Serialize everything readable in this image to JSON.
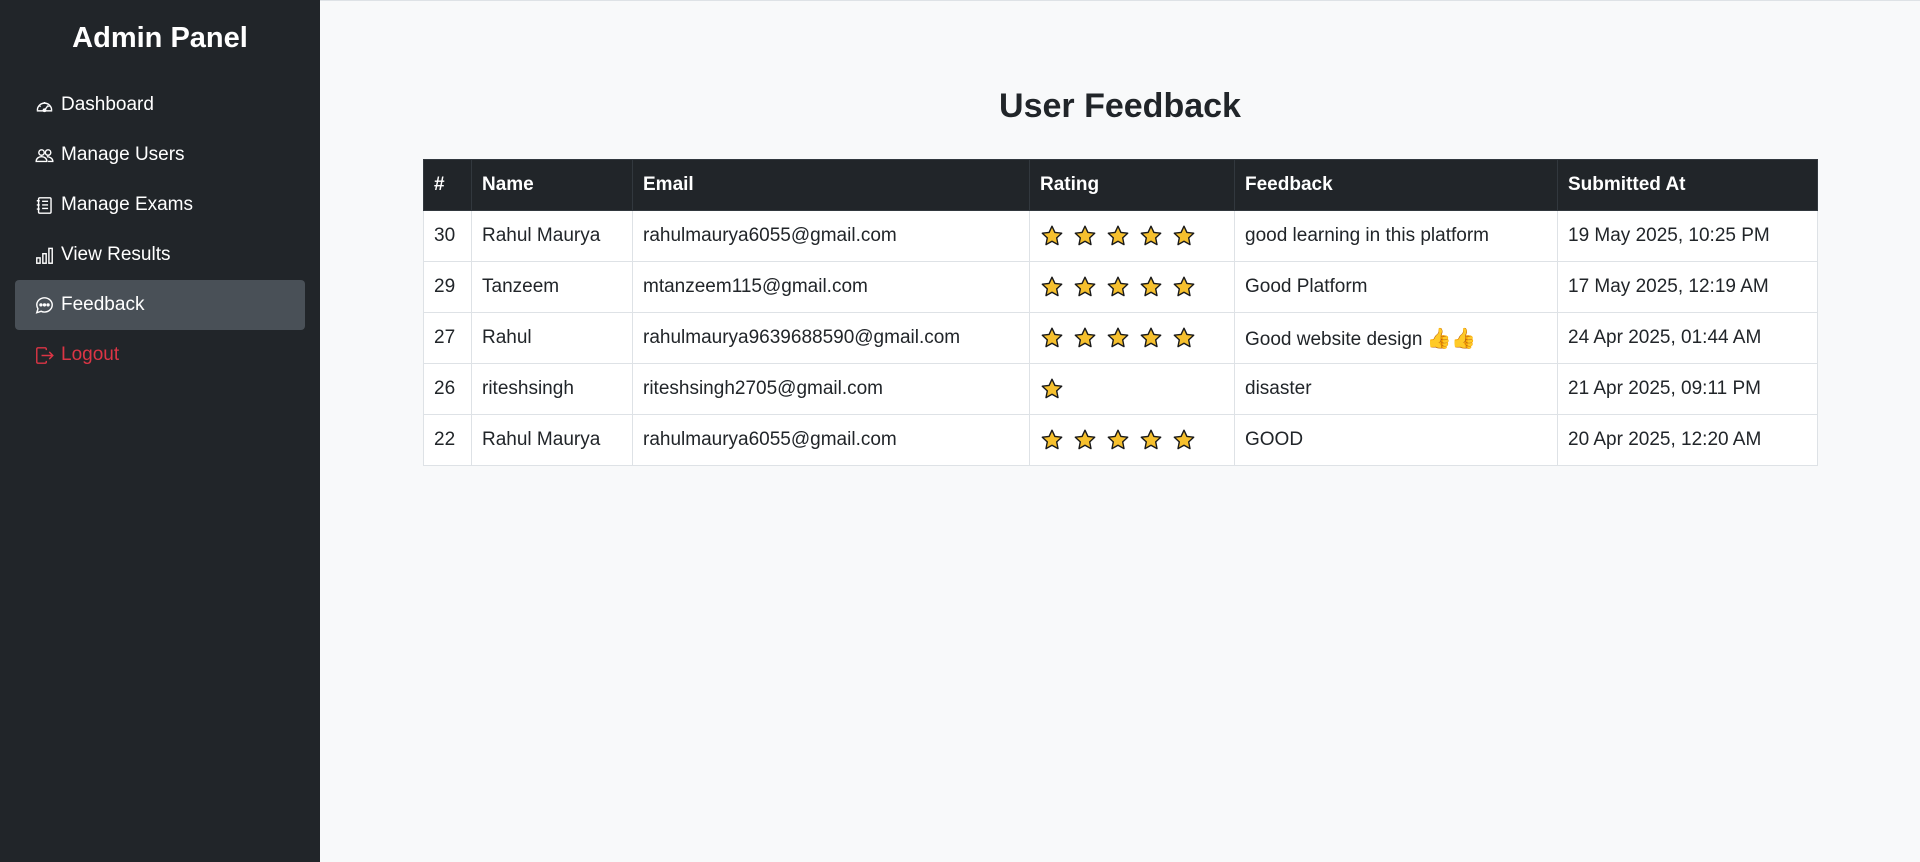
{
  "sidebar": {
    "title": "Admin Panel",
    "items": [
      {
        "label": "Dashboard",
        "icon": "speedometer-icon"
      },
      {
        "label": "Manage Users",
        "icon": "users-icon"
      },
      {
        "label": "Manage Exams",
        "icon": "journal-icon"
      },
      {
        "label": "View Results",
        "icon": "bar-chart-icon"
      },
      {
        "label": "Feedback",
        "icon": "chat-dots-icon",
        "active": true
      },
      {
        "label": "Logout",
        "icon": "logout-icon",
        "color": "#dc3545"
      }
    ]
  },
  "main": {
    "title": "User Feedback",
    "table": {
      "headers": [
        "#",
        "Name",
        "Email",
        "Rating",
        "Feedback",
        "Submitted At"
      ],
      "rows": [
        {
          "id": "30",
          "name": "Rahul Maurya",
          "email": "rahulmaurya6055@gmail.com",
          "rating": 5,
          "feedback": "good learning in this platform",
          "submitted_at": "19 May 2025, 10:25 PM"
        },
        {
          "id": "29",
          "name": "Tanzeem",
          "email": "mtanzeem115@gmail.com",
          "rating": 5,
          "feedback": "Good Platform",
          "submitted_at": "17 May 2025, 12:19 AM"
        },
        {
          "id": "27",
          "name": "Rahul",
          "email": "rahulmaurya9639688590@gmail.com",
          "rating": 5,
          "feedback": "Good website design",
          "feedback_emoji": "👍👍",
          "submitted_at": "24 Apr 2025, 01:44 AM"
        },
        {
          "id": "26",
          "name": "riteshsingh",
          "email": "riteshsingh2705@gmail.com",
          "rating": 1,
          "feedback": "disaster",
          "submitted_at": "21 Apr 2025, 09:11 PM"
        },
        {
          "id": "22",
          "name": "Rahul Maurya",
          "email": "rahulmaurya6055@gmail.com",
          "rating": 5,
          "feedback": "GOOD",
          "submitted_at": "20 Apr 2025, 12:20 AM"
        }
      ]
    }
  },
  "colors": {
    "sidebar_bg": "#212529",
    "active_bg": "#495057",
    "logout": "#dc3545",
    "star": "#f6c02e"
  }
}
